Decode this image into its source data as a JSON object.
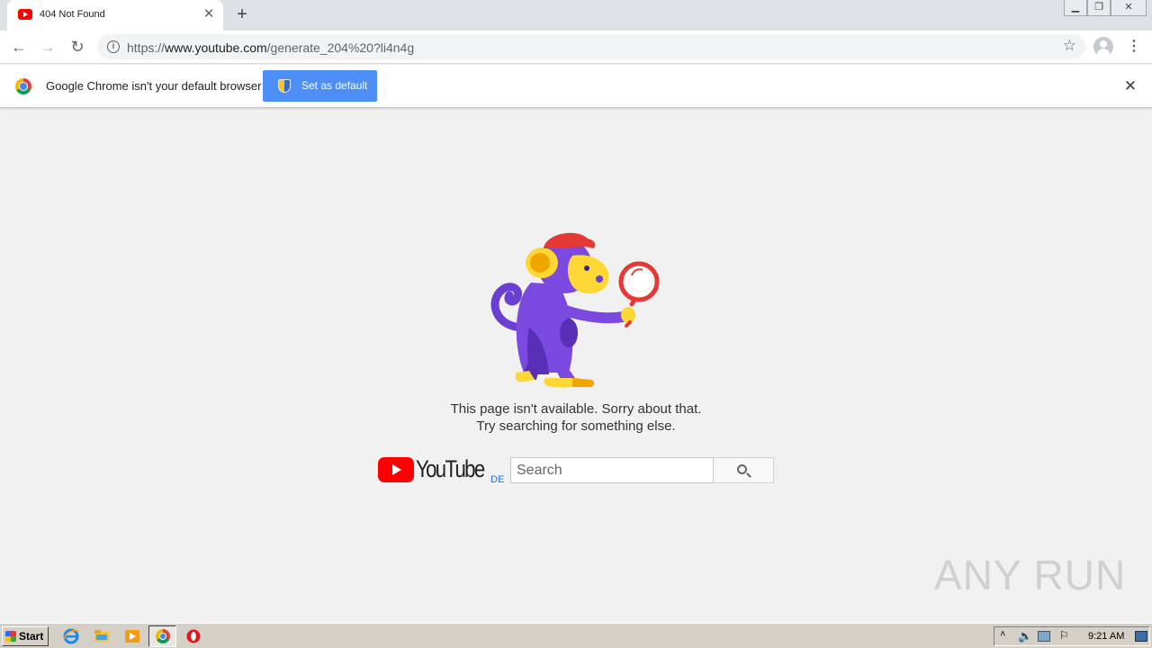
{
  "browser": {
    "tab": {
      "title": "404 Not Found"
    },
    "url": {
      "prefix": "https://",
      "host": "www.youtube.com",
      "path": "/generate_204%20?li4n4g"
    }
  },
  "infobar": {
    "message": "Google Chrome isn't your default browser",
    "button_label": "Set as default"
  },
  "page": {
    "error_line1": "This page isn't available. Sorry about that.",
    "error_line2": "Try searching for something else.",
    "logo_text": "YouTube",
    "country_code": "DE",
    "search_placeholder": "Search"
  },
  "watermark": "ANY RUN",
  "taskbar": {
    "start_label": "Start",
    "clock": "9:21 AM"
  },
  "colors": {
    "youtube_red": "#ff0000",
    "infobar_button": "#4d8ef7",
    "monkey_purple": "#6b3fd4",
    "monkey_face": "#fdd835",
    "cap_red": "#e53935"
  }
}
